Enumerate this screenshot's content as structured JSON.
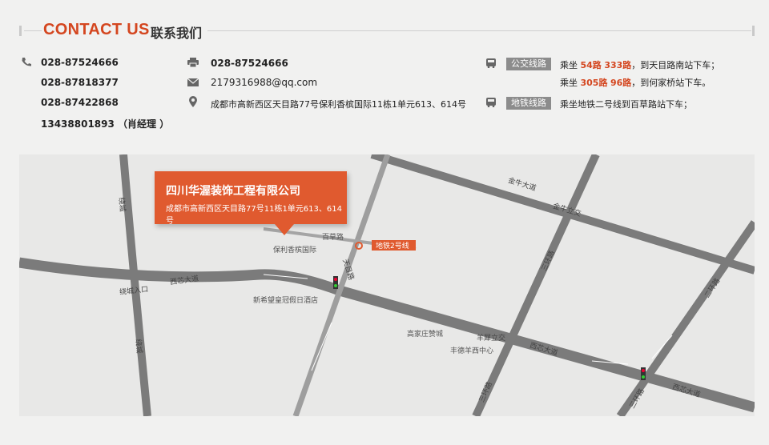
{
  "header": {
    "title_en": "CONTACT US",
    "title_cn": "联系我们"
  },
  "phones": [
    "028-87524666",
    "028-87818377",
    "028-87422868",
    "13438801893 （肖经理 ）"
  ],
  "fax": "028-87524666",
  "email": "2179316988@qq.com",
  "address": "成都市高新西区天目路77号保利香槟国际11栋1单元613、614号",
  "transit": {
    "bus_label": "公交线路",
    "bus_line1": {
      "pre": "乘坐",
      "r1": "54路",
      "r2": "333路",
      "post": "，到天目路南站下车；"
    },
    "bus_line2": {
      "pre": "乘坐",
      "r1": "305路",
      "r2": "96路",
      "post": "，到何家桥站下车。"
    },
    "metro_label": "地铁线路",
    "metro_line": "乘坐地铁二号线到百草路站下车；"
  },
  "map": {
    "company_name": "四川华渥装饰工程有限公司",
    "company_address": "成都市高新西区天目路77号11栋1单元613、614号",
    "metro_tag": "地铁2号线",
    "labels": {
      "baicao": "百草路",
      "baoli": "保利香槟国际",
      "xinxiwang": "新希望皇冠假日酒店",
      "gaojiazhuang": "高家庄赞城",
      "fengde": "丰德羊西中心",
      "jinniu": "金牛大道",
      "jinniu_li": "金牛立交",
      "xixin1": "西芯大道",
      "xixin2": "西芯大道",
      "xixin3": "西芯大道",
      "tianmu": "天目路",
      "raocheng_in": "绕城入口",
      "raocheng1": "绕城",
      "raocheng2": "绕城",
      "huan3a": "三环路",
      "huan3b": "三环路",
      "huan3c": "三环路",
      "yangxi": "羊犀立交",
      "huan2": "二环路"
    }
  }
}
